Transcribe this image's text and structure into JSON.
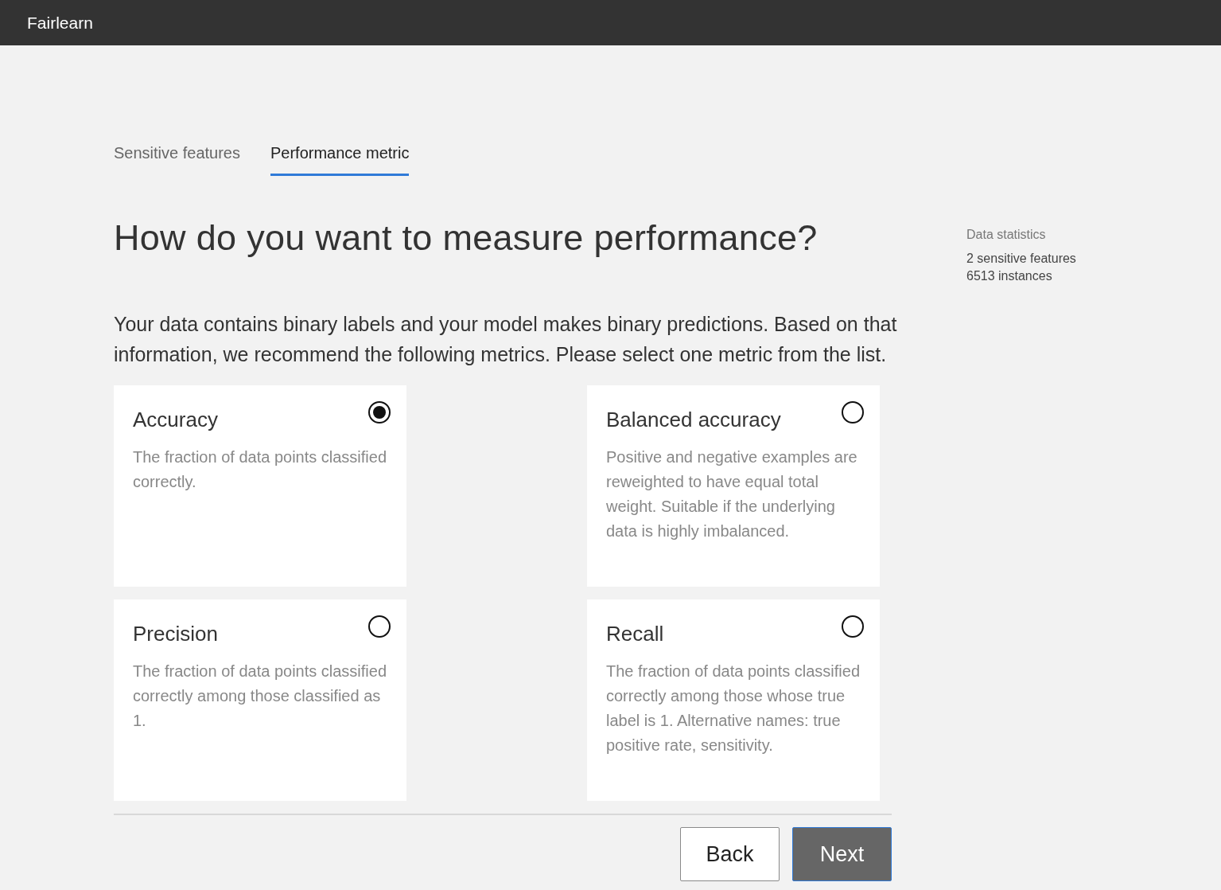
{
  "app_bar": {
    "title": "Fairlearn"
  },
  "tabs": [
    {
      "label": "Sensitive features",
      "selected": false
    },
    {
      "label": "Performance metric",
      "selected": true
    }
  ],
  "heading": "How do you want to measure performance?",
  "description": "Your data contains binary labels and your model makes binary predictions. Based on that information, we recommend the following metrics. Please select one metric from the list.",
  "metrics": [
    {
      "title": "Accuracy",
      "description": "The fraction of data points classified correctly.",
      "selected": true
    },
    {
      "title": "Balanced accuracy",
      "description": "Positive and negative examples are reweighted to have equal total weight. Suitable if the underlying data is highly imbalanced.",
      "selected": false
    },
    {
      "title": "Precision",
      "description": "The fraction of data points classified correctly among those classified as 1.",
      "selected": false
    },
    {
      "title": "Recall",
      "description": "The fraction of data points classified correctly among those whose true label is 1. Alternative names: true positive rate, sensitivity.",
      "selected": false
    }
  ],
  "data_statistics": {
    "title": "Data statistics",
    "lines": [
      "2 sensitive features",
      "6513 instances"
    ]
  },
  "buttons": {
    "back": "Back",
    "next": "Next"
  }
}
